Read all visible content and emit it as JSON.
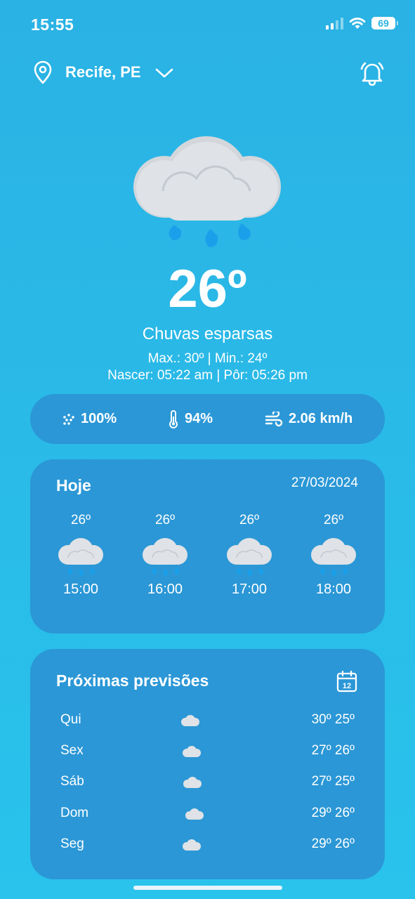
{
  "status_bar": {
    "time": "15:55",
    "battery": "69"
  },
  "location": {
    "name": "Recife, PE"
  },
  "current": {
    "temperature": "26º",
    "condition": "Chuvas esparsas",
    "minmax": "Max.: 30º | Min.: 24º",
    "sun": "Nascer: 05:22 am | Pôr: 05:26 pm",
    "icon": "rain-cloud-icon"
  },
  "stats": {
    "rain": "100%",
    "humidity": "94%",
    "wind": "2.06 km/h"
  },
  "today": {
    "title": "Hoje",
    "date": "27/03/2024",
    "hours": [
      {
        "temp": "26º",
        "time": "15:00"
      },
      {
        "temp": "26º",
        "time": "16:00"
      },
      {
        "temp": "26º",
        "time": "17:00"
      },
      {
        "temp": "26º",
        "time": "18:00"
      }
    ]
  },
  "forecast": {
    "title": "Próximas previsões",
    "days": [
      {
        "day": "Qui",
        "temps": "30º 25º"
      },
      {
        "day": "Sex",
        "temps": "27º 26º"
      },
      {
        "day": "Sáb",
        "temps": "27º 25º"
      },
      {
        "day": "Dom",
        "temps": "29º 26º"
      },
      {
        "day": "Seg",
        "temps": "29º 26º"
      }
    ]
  },
  "colors": {
    "background": "#2ab2e4",
    "card": "#2b97d6",
    "cloud": "#d9dde2",
    "rain_drop": "#1aa0ea"
  }
}
